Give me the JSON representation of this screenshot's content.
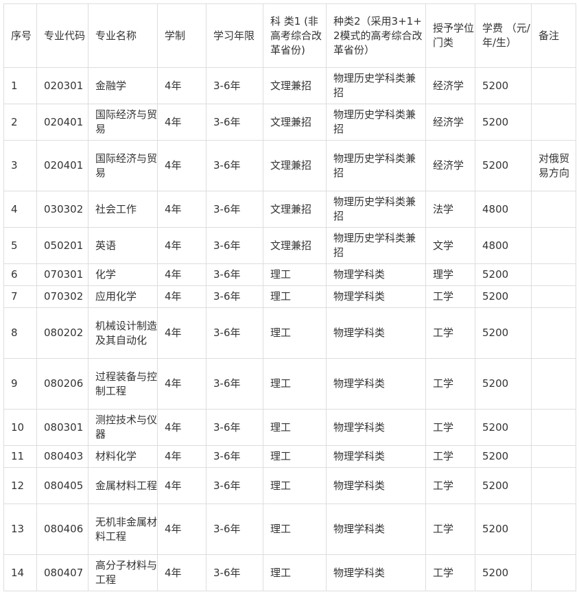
{
  "headers": [
    "序号",
    "专业代码",
    "专业名称",
    "学制",
    "学习年限",
    "科 类1 (非高考综合改革省份)",
    "种类2（采用3+1+2模式的高考综合改革省份）",
    "授予学位门类",
    "学费 （元/年/生）",
    "备注"
  ],
  "rows": [
    [
      "1",
      "020301",
      "金融学",
      "4年",
      "3-6年",
      "文理兼招",
      "物理历史学科类兼招",
      "经济学",
      "5200",
      ""
    ],
    [
      "2",
      "020401",
      "国际经济与贸易",
      "4年",
      "3-6年",
      "文理兼招",
      "物理历史学科类兼招",
      "经济学",
      "5200",
      ""
    ],
    [
      "3",
      "020401",
      "国际经济与贸易",
      "4年",
      "3-6年",
      "文理兼招",
      "物理历史学科类兼招",
      "经济学",
      "5200",
      "对俄贸易方向"
    ],
    [
      "4",
      "030302",
      "社会工作",
      "4年",
      "3-6年",
      "文理兼招",
      "物理历史学科类兼招",
      "法学",
      "4800",
      ""
    ],
    [
      "5",
      "050201",
      "英语",
      "4年",
      "3-6年",
      "文理兼招",
      "物理历史学科类兼招",
      "文学",
      "4800",
      ""
    ],
    [
      "6",
      "070301",
      "化学",
      "4年",
      "3-6年",
      "理工",
      "物理学科类",
      "理学",
      "5200",
      ""
    ],
    [
      "7",
      "070302",
      "应用化学",
      "4年",
      "3-6年",
      "理工",
      "物理学科类",
      "工学",
      "5200",
      ""
    ],
    [
      "8",
      "080202",
      "机械设计制造及其自动化",
      "4年",
      "3-6年",
      "理工",
      "物理学科类",
      "工学",
      "5200",
      ""
    ],
    [
      "9",
      "080206",
      "过程装备与控制工程",
      "4年",
      "3-6年",
      "理工",
      "物理学科类",
      "工学",
      "5200",
      ""
    ],
    [
      "10",
      "080301",
      "测控技术与仪器",
      "4年",
      "3-6年",
      "理工",
      "物理学科类",
      "工学",
      "5200",
      ""
    ],
    [
      "11",
      "080403",
      "材料化学",
      "4年",
      "3-6年",
      "理工",
      "物理学科类",
      "工学",
      "5200",
      ""
    ],
    [
      "12",
      "080405",
      "金属材料工程",
      "4年",
      "3-6年",
      "理工",
      "物理学科类",
      "工学",
      "5200",
      ""
    ],
    [
      "13",
      "080406",
      "无机非金属材料工程",
      "4年",
      "3-6年",
      "理工",
      "物理学科类",
      "工学",
      "5200",
      ""
    ],
    [
      "14",
      "080407",
      "高分子材料与工程",
      "4年",
      "3-6年",
      "理工",
      "物理学科类",
      "工学",
      "5200",
      ""
    ]
  ]
}
